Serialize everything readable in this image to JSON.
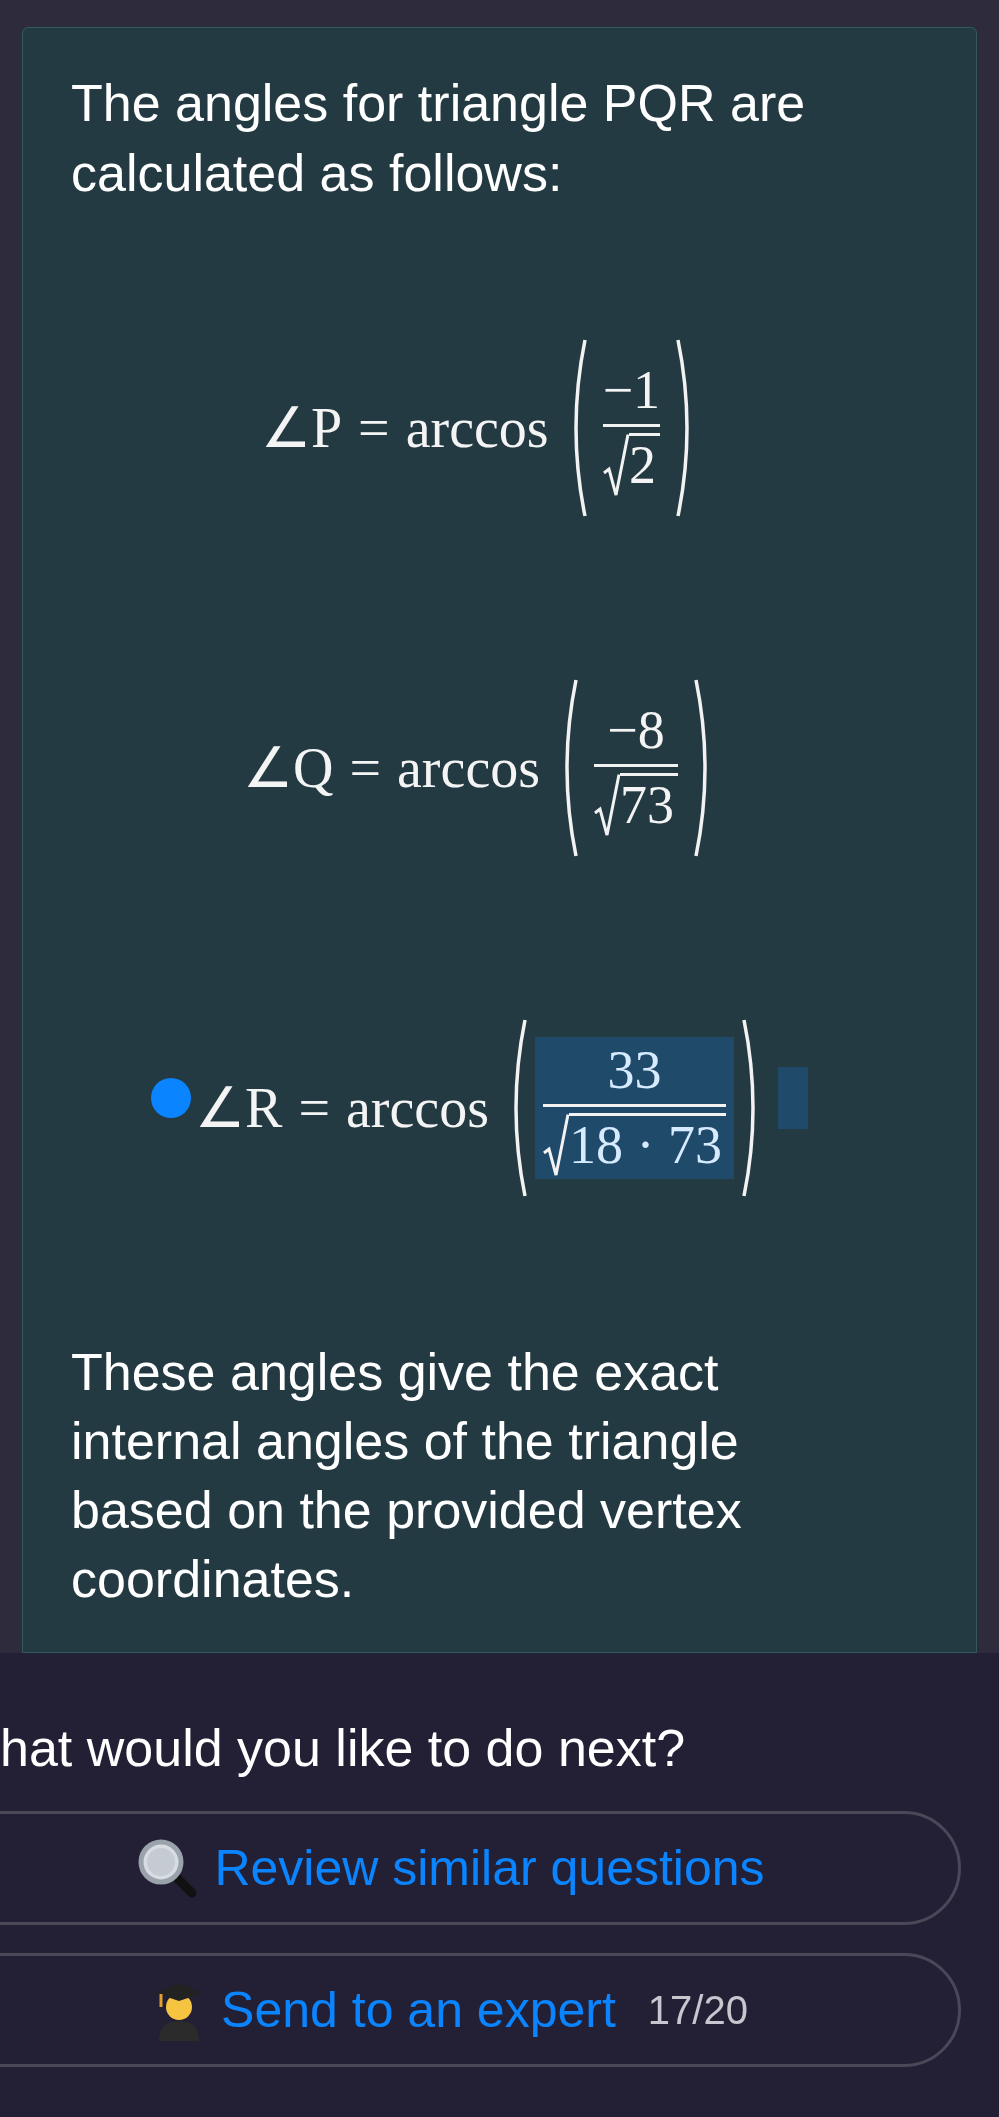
{
  "message": {
    "intro": "The angles for triangle PQR are calculated as follows:",
    "equations": [
      {
        "lhs": "∠P",
        "relation": "=",
        "function": "arccos",
        "numerator": "−1",
        "radicand": "2",
        "selected": false
      },
      {
        "lhs": "∠Q",
        "relation": "=",
        "function": "arccos",
        "numerator": "−8",
        "radicand": "73",
        "selected": false
      },
      {
        "lhs": "∠R",
        "relation": "=",
        "function": "arccos",
        "numerator": "33",
        "radicand": "18 · 73",
        "selected": true
      }
    ],
    "conclusion": "These angles give the exact internal angles of the triangle based on the provided vertex coordinates."
  },
  "next_steps": {
    "prompt": "hat would you like to do next?",
    "actions": [
      {
        "kind": "search",
        "label": "Review similar questions"
      },
      {
        "kind": "expert",
        "label": "Send to an expert",
        "count": "17/20"
      }
    ]
  }
}
